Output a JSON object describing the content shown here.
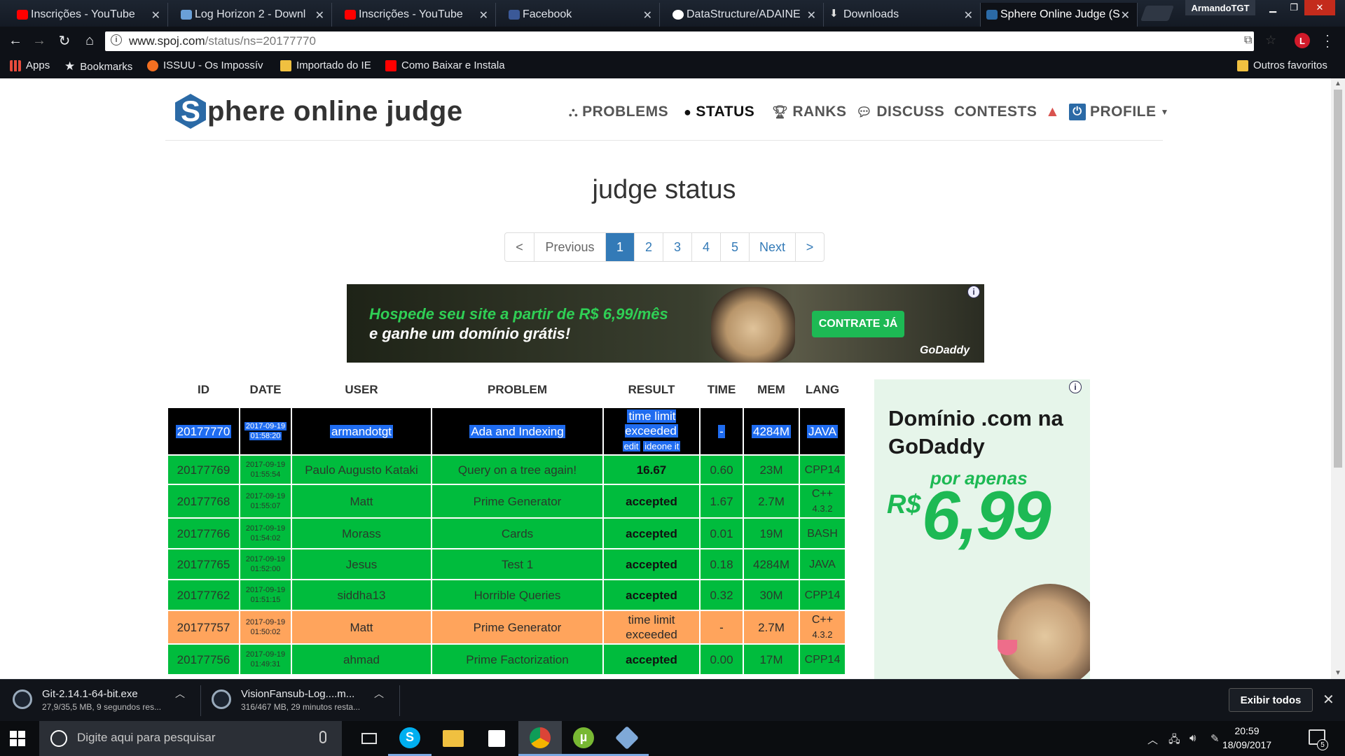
{
  "browser": {
    "tabs": [
      {
        "title": "Inscrições - YouTube",
        "icon": "youtube-icon",
        "color": "#ff0000"
      },
      {
        "title": "Log Horizon 2 - Downl",
        "icon": "page-icon",
        "color": "#6aa0d8"
      },
      {
        "title": "Inscrições - YouTube",
        "icon": "youtube-icon",
        "color": "#ff0000"
      },
      {
        "title": "Facebook",
        "icon": "facebook-icon",
        "color": "#3b5998"
      },
      {
        "title": "DataStructure/ADAINE",
        "icon": "github-icon",
        "color": "#ffffff"
      },
      {
        "title": "Downloads",
        "icon": "download-icon",
        "color": "#dddddd"
      },
      {
        "title": "Sphere Online Judge (S",
        "icon": "spoj-icon",
        "color": "#2b6aa6"
      }
    ],
    "profile_name": "ArmandoTGT",
    "url_host": "www.spoj.com",
    "url_path": "/status/ns=20177770",
    "bookmarks": [
      {
        "label": "Apps",
        "icon": "apps-grid-icon"
      },
      {
        "label": "Bookmarks",
        "icon": "star-icon"
      },
      {
        "label": "ISSUU - Os Impossív",
        "icon": "issuu-icon"
      },
      {
        "label": "Importado do IE",
        "icon": "folder-icon"
      },
      {
        "label": "Como Baixar e Instala",
        "icon": "youtube-icon"
      },
      {
        "label": "Outros favoritos",
        "icon": "folder-icon"
      }
    ]
  },
  "site": {
    "logo_letter": "S",
    "logo_text": "phere online judge",
    "nav": {
      "problems": "PROBLEMS",
      "status": "STATUS",
      "ranks": "RANKS",
      "discuss": "DISCUSS",
      "contests": "CONTESTS",
      "profile": "PROFILE"
    },
    "title": "judge status",
    "pagination": {
      "first": "<",
      "previous": "Previous",
      "pages": [
        "1",
        "2",
        "3",
        "4",
        "5"
      ],
      "current": "1",
      "next": "Next",
      "last": ">"
    }
  },
  "ad_banner": {
    "line1": "Hospede seu site a partir de R$ 6,99/mês",
    "line2": "e ganhe um domínio grátis!",
    "cta": "CONTRATE JÁ",
    "brand": "GoDaddy"
  },
  "ad_side": {
    "line1": "Domínio .com na",
    "line2": "GoDaddy",
    "line3": "por apenas",
    "currency": "R$",
    "price": "6,99"
  },
  "table": {
    "headers": {
      "id": "ID",
      "date": "DATE",
      "user": "USER",
      "problem": "PROBLEM",
      "result": "RESULT",
      "time": "TIME",
      "mem": "MEM",
      "lang": "LANG"
    },
    "rows": [
      {
        "id": "20177770",
        "date": "2017-09-19",
        "time_of_day": "01:58:20",
        "user": "armandotgt",
        "problem": "Ada and Indexing",
        "result": "time limit exceeded",
        "edit": "edit",
        "ideone": "ideone it",
        "time": "-",
        "mem": "4284M",
        "lang": "JAVA",
        "lang_ver": "",
        "status": "own"
      },
      {
        "id": "20177769",
        "date": "2017-09-19",
        "time_of_day": "01:55:54",
        "user": "Paulo Augusto Kataki",
        "problem": "Query on a tree again!",
        "result": "16.67",
        "time": "0.60",
        "mem": "23M",
        "lang": "CPP14",
        "lang_ver": "",
        "status": "accepted"
      },
      {
        "id": "20177768",
        "date": "2017-09-19",
        "time_of_day": "01:55:07",
        "user": "Matt",
        "problem": "Prime Generator",
        "result": "accepted",
        "time": "1.67",
        "mem": "2.7M",
        "lang": "C++",
        "lang_ver": "4.3.2",
        "status": "accepted"
      },
      {
        "id": "20177766",
        "date": "2017-09-19",
        "time_of_day": "01:54:02",
        "user": "Morass",
        "problem": "Cards",
        "result": "accepted",
        "time": "0.01",
        "mem": "19M",
        "lang": "BASH",
        "lang_ver": "",
        "status": "accepted"
      },
      {
        "id": "20177765",
        "date": "2017-09-19",
        "time_of_day": "01:52:00",
        "user": "Jesus",
        "problem": "Test 1",
        "result": "accepted",
        "time": "0.18",
        "mem": "4284M",
        "lang": "JAVA",
        "lang_ver": "",
        "status": "accepted"
      },
      {
        "id": "20177762",
        "date": "2017-09-19",
        "time_of_day": "01:51:15",
        "user": "siddha13",
        "problem": "Horrible Queries",
        "result": "accepted",
        "time": "0.32",
        "mem": "30M",
        "lang": "CPP14",
        "lang_ver": "",
        "status": "accepted"
      },
      {
        "id": "20177757",
        "date": "2017-09-19",
        "time_of_day": "01:50:02",
        "user": "Matt",
        "problem": "Prime Generator",
        "result": "time limit exceeded",
        "time": "-",
        "mem": "2.7M",
        "lang": "C++",
        "lang_ver": "4.3.2",
        "status": "tle"
      },
      {
        "id": "20177756",
        "date": "2017-09-19",
        "time_of_day": "01:49:31",
        "user": "ahmad",
        "problem": "Prime Factorization",
        "result": "accepted",
        "time": "0.00",
        "mem": "17M",
        "lang": "CPP14",
        "lang_ver": "",
        "status": "accepted"
      }
    ]
  },
  "downloads": [
    {
      "name": "Git-2.14.1-64-bit.exe",
      "status": "27,9/35,5 MB, 9 segundos res..."
    },
    {
      "name": "VisionFansub-Log....m...",
      "status": "316/467 MB, 29 minutos resta..."
    }
  ],
  "downloads_show_all": "Exibir todos",
  "taskbar": {
    "search_placeholder": "Digite aqui para pesquisar",
    "time": "20:59",
    "date": "18/09/2017",
    "notifications": "5",
    "apps": [
      {
        "name": "skype-icon",
        "glyph": "S",
        "color": "#00aff0"
      },
      {
        "name": "file-explorer-icon",
        "glyph": "",
        "color": "#f0c040"
      },
      {
        "name": "store-icon",
        "glyph": "",
        "color": "#444444"
      },
      {
        "name": "chrome-icon",
        "glyph": "",
        "color": "#db4437"
      },
      {
        "name": "utorrent-icon",
        "glyph": "µ",
        "color": "#78b833"
      },
      {
        "name": "virtualbox-icon",
        "glyph": "",
        "color": "#7fa9d8"
      }
    ]
  }
}
